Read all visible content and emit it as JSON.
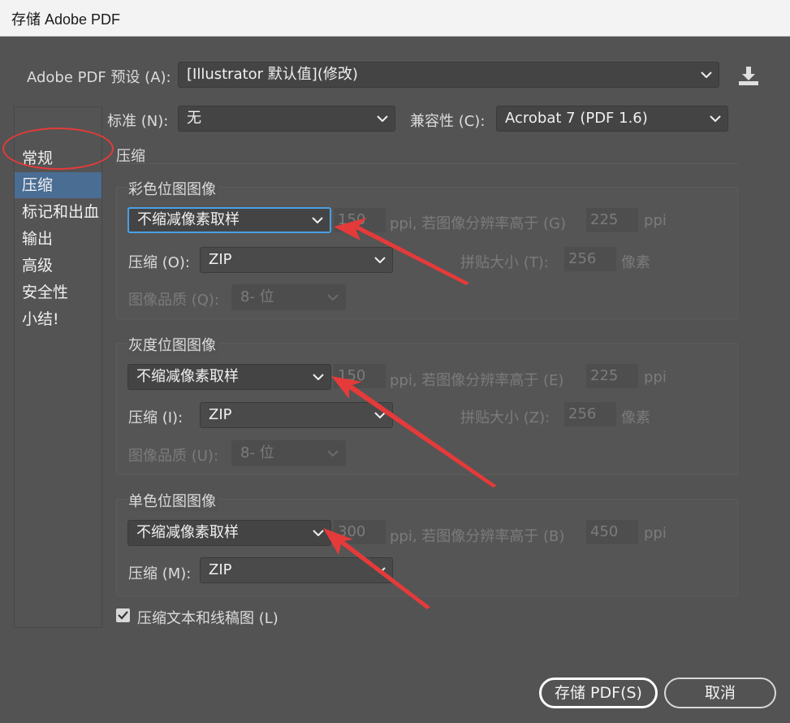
{
  "window": {
    "title": "存储 Adobe PDF"
  },
  "preset": {
    "label": "Adobe PDF 预设 (A):",
    "value": "[Illustrator 默认值](修改)"
  },
  "standard": {
    "label": "标准 (N):",
    "value": "无"
  },
  "compat": {
    "label": "兼容性 (C):",
    "value": "Acrobat 7 (PDF 1.6)"
  },
  "sidebar": {
    "items": [
      {
        "label": "常规"
      },
      {
        "label": "压缩"
      },
      {
        "label": "标记和出血"
      },
      {
        "label": "输出"
      },
      {
        "label": "高级"
      },
      {
        "label": "安全性"
      },
      {
        "label": "小结!"
      }
    ]
  },
  "section_title": "压缩",
  "color": {
    "title": "彩色位图图像",
    "sampling": "不缩减像素取样",
    "ppi_value": "150",
    "ppi_label": "ppi, 若图像分辨率高于 (G)",
    "above_value": "225",
    "above_unit": "ppi",
    "compression_label": "压缩 (O):",
    "compression": "ZIP",
    "tile_label": "拼贴大小 (T):",
    "tile_value": "256",
    "tile_unit": "像素",
    "quality_label": "图像品质 (Q):",
    "quality": "8- 位"
  },
  "gray": {
    "title": "灰度位图图像",
    "sampling": "不缩减像素取样",
    "ppi_value": "150",
    "ppi_label": "ppi, 若图像分辨率高于 (E)",
    "above_value": "225",
    "above_unit": "ppi",
    "compression_label": "压缩 (I):",
    "compression": "ZIP",
    "tile_label": "拼贴大小 (Z):",
    "tile_value": "256",
    "tile_unit": "像素",
    "quality_label": "图像品质 (U):",
    "quality": "8- 位"
  },
  "mono": {
    "title": "单色位图图像",
    "sampling": "不缩减像素取样",
    "ppi_value": "300",
    "ppi_label": "ppi, 若图像分辨率高于 (B)",
    "above_value": "450",
    "above_unit": "ppi",
    "compression_label": "压缩 (M):",
    "compression": "ZIP"
  },
  "compress_text": {
    "label": "压缩文本和线稿图 (L)",
    "checked": true
  },
  "buttons": {
    "save": "存储 PDF(S)",
    "cancel": "取消"
  },
  "colors": {
    "accent": "#4a6d94",
    "focus": "#4aa0e6",
    "annotation": "#e53a3a"
  },
  "icons": {
    "save_preset": "download-tray-icon",
    "chevron": "chevron-down-icon",
    "check": "checkmark-icon"
  }
}
